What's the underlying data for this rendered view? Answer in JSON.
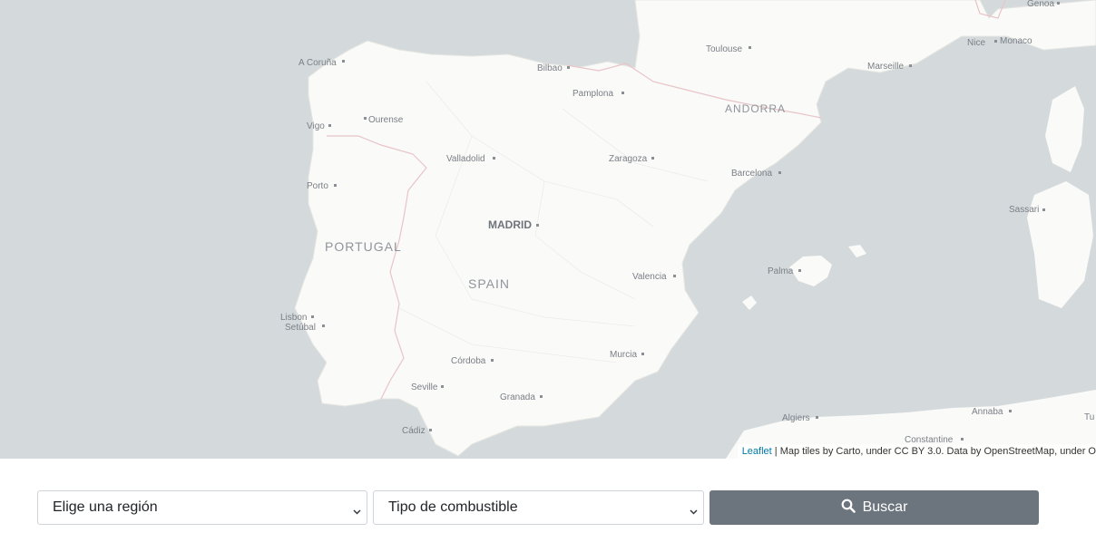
{
  "map": {
    "countries": [
      "PORTUGAL",
      "SPAIN",
      "ANDORRA"
    ],
    "capital": "MADRID",
    "cities": [
      "A Coruña",
      "Ourense",
      "Vigo",
      "Bilbao",
      "Pamplona",
      "Toulouse",
      "Marseille",
      "Nice",
      "Monaco",
      "Genoa",
      "Valladolid",
      "Zaragoza",
      "Barcelona",
      "Porto",
      "Sassari",
      "Valencia",
      "Palma",
      "Lisbon",
      "Setúbal",
      "Córdoba",
      "Murcia",
      "Seville",
      "Granada",
      "Cádiz",
      "Algiers",
      "Annaba",
      "Constantine",
      "Tu"
    ],
    "attribution": {
      "link": "Leaflet",
      "text": " | Map tiles by Carto, under CC BY 3.0. Data by OpenStreetMap, under O"
    }
  },
  "controls": {
    "region_value": "Elige una región",
    "fuel_value": "Tipo de combustible",
    "search_label": "Buscar"
  },
  "colors": {
    "sea": "#d4dadc",
    "land": "#fafaf8",
    "border": "#e8c4c8",
    "button": "#6c757d"
  }
}
